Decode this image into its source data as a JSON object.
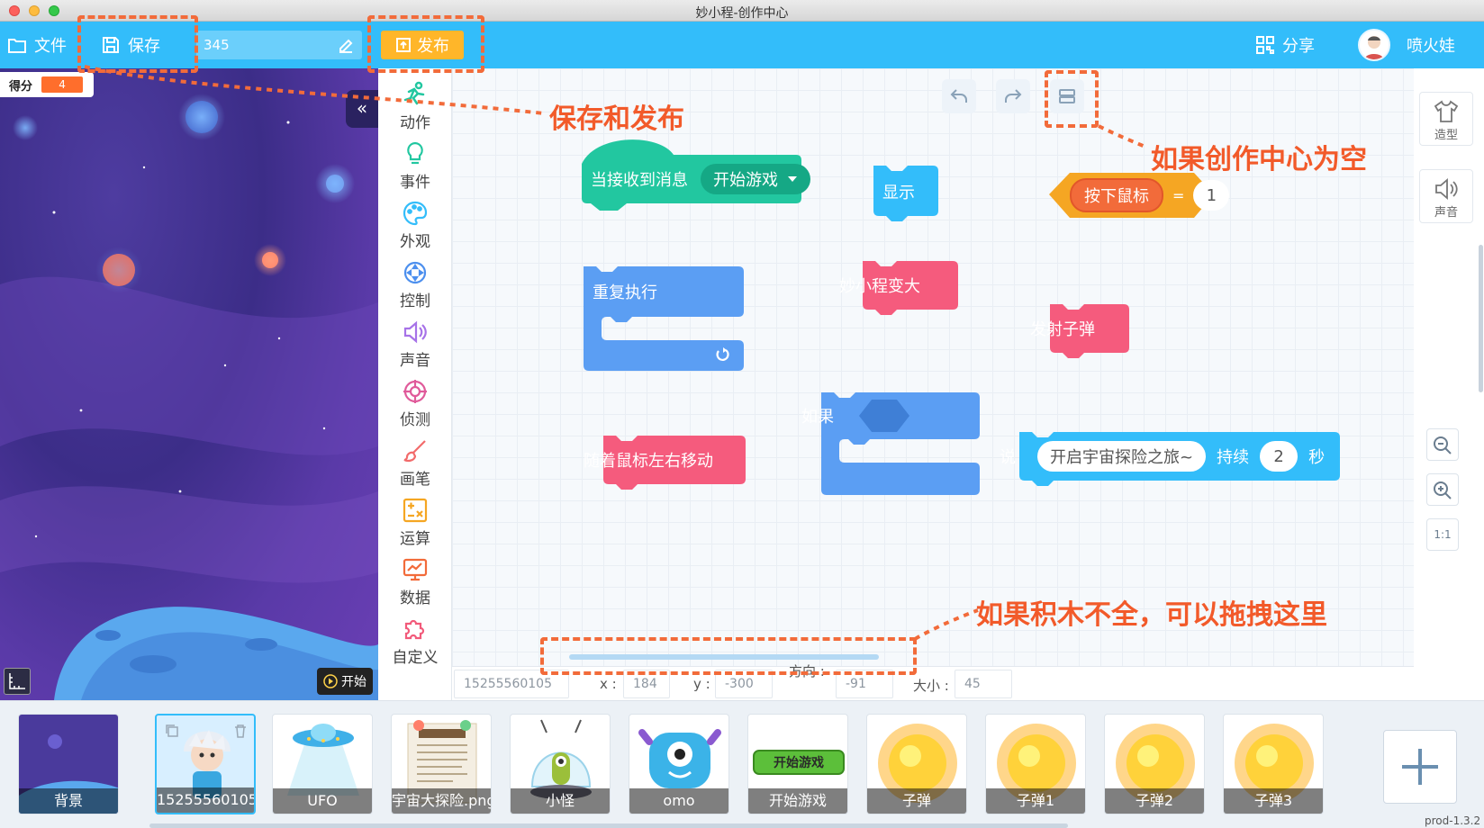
{
  "window": {
    "title": "妙小程-创作中心"
  },
  "toolbar": {
    "file_label": "文件",
    "save_label": "保存",
    "project_name": "345",
    "publish_label": "发布",
    "share_label": "分享",
    "username": "喷火娃",
    "background_color": "#33bdfa",
    "publish_color": "#ffb629"
  },
  "stage": {
    "score_label": "得分",
    "score_value": "4",
    "collapse_icon": "double-chevron-left-icon",
    "start_label": "开始"
  },
  "categories": [
    {
      "label": "动作",
      "icon": "run-icon",
      "color": "#22c7a0"
    },
    {
      "label": "事件",
      "icon": "bulb-icon",
      "color": "#22c7a0"
    },
    {
      "label": "外观",
      "icon": "palette-icon",
      "color": "#33bdfa"
    },
    {
      "label": "控制",
      "icon": "control-icon",
      "color": "#4c8fee"
    },
    {
      "label": "声音",
      "icon": "speaker-icon",
      "color": "#a772e8"
    },
    {
      "label": "侦测",
      "icon": "target-icon",
      "color": "#e05a9a"
    },
    {
      "label": "画笔",
      "icon": "brush-icon",
      "color": "#f26b6b"
    },
    {
      "label": "运算",
      "icon": "math-icon",
      "color": "#f5a623"
    },
    {
      "label": "数据",
      "icon": "monitor-icon",
      "color": "#f26b3a"
    },
    {
      "label": "自定义",
      "icon": "puzzle-icon",
      "color": "#f25a7a"
    }
  ],
  "blocks": {
    "receive_message": "当接收到消息",
    "message_value": "开始游戏",
    "show": "显示",
    "mouse_down": "按下鼠标",
    "equals": "=",
    "mouse_value": "1",
    "repeat": "重复执行",
    "grow": "妙小程变大",
    "fire": "发射子弹",
    "if": "如果",
    "follow_mouse": "随着鼠标左右移动",
    "say": "说",
    "say_text": "开启宇宙探险之旅~",
    "for_label": "持续",
    "seconds": "2",
    "seconds_unit": "秒"
  },
  "right_tools": {
    "costume_label": "造型",
    "sound_label": "声音",
    "fit_label": "1:1"
  },
  "properties": {
    "name_value": "15255560105",
    "x_label": "x :",
    "x_value": "184",
    "y_label": "y :",
    "y_value": "-300",
    "direction_label": "方向 :",
    "direction_value": "-91",
    "size_label": "大小 :",
    "size_value": "45"
  },
  "sprites": [
    {
      "label": "背景",
      "kind": "background"
    },
    {
      "label": "15255560105",
      "kind": "character",
      "selected": true
    },
    {
      "label": "UFO",
      "kind": "ufo"
    },
    {
      "label": "宇宙大探险.png",
      "kind": "poster"
    },
    {
      "label": "小怪",
      "kind": "alien"
    },
    {
      "label": "omo",
      "kind": "monster"
    },
    {
      "label": "开始游戏",
      "kind": "button"
    },
    {
      "label": "子弹",
      "kind": "sun"
    },
    {
      "label": "子弹1",
      "kind": "sun"
    },
    {
      "label": "子弹2",
      "kind": "sun"
    },
    {
      "label": "子弹3",
      "kind": "sun"
    }
  ],
  "version": "prod-1.3.2",
  "annotations": {
    "save_publish": "保存和发布",
    "empty_center": "如果创作中心为空",
    "drag_here": "如果积木不全，可以拖拽这里",
    "color": "#f26b3a"
  }
}
